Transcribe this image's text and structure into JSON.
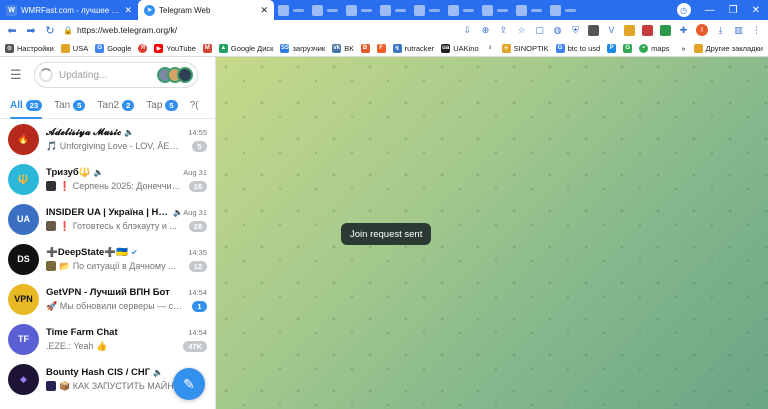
{
  "browser": {
    "tabs": [
      {
        "title": "WMRFast.com - лучшее место дл",
        "favicon": "W",
        "favicon_color": "#4a86e8",
        "active": false
      },
      {
        "title": "Telegram Web",
        "favicon": "➤",
        "favicon_color": "#3390ec",
        "active": true
      }
    ],
    "url": "https://web.telegram.org/k/"
  },
  "bookmarks": [
    {
      "label": "Настройки",
      "icon": "gear-icon",
      "color": "#555555"
    },
    {
      "label": "USA",
      "icon": "folder-icon",
      "color": "#e0a526"
    },
    {
      "label": "Google",
      "icon": "G",
      "color": "#4285f4"
    },
    {
      "label": "",
      "icon": "ya-icon",
      "color": "#e23b2e"
    },
    {
      "label": "YouTube",
      "icon": "▶",
      "color": "#ff0000"
    },
    {
      "label": "",
      "icon": "M",
      "color": "#d44638"
    },
    {
      "label": "Google Диск",
      "icon": "▲",
      "color": "#1fa463"
    },
    {
      "label": "загрузчик",
      "icon": "SS",
      "color": "#2d7be0"
    },
    {
      "label": "ВК",
      "icon": "vk",
      "color": "#4a76a8"
    },
    {
      "label": "",
      "icon": "B",
      "color": "#e05a2a"
    },
    {
      "label": "",
      "icon": "F",
      "color": "#f25c27"
    },
    {
      "label": "rutracker",
      "icon": "↯",
      "color": "#3b78c2"
    },
    {
      "label": "UAKino",
      "icon": "ua",
      "color": "#222222"
    },
    {
      "label": "",
      "icon": "🌡",
      "color": "#333333"
    },
    {
      "label": "SINOPTIK",
      "icon": "☀",
      "color": "#e0a526"
    },
    {
      "label": "btc to usd",
      "icon": "G",
      "color": "#4285f4"
    },
    {
      "label": "",
      "icon": "P",
      "color": "#1e88e5"
    },
    {
      "label": "",
      "icon": "G",
      "color": "#34a853"
    },
    {
      "label": "maps",
      "icon": "📍",
      "color": "#34a853"
    }
  ],
  "bookmarks_other": "Другие закладки",
  "search": {
    "placeholder": "Updating..."
  },
  "folders": [
    {
      "label": "All",
      "count": "23",
      "active": true
    },
    {
      "label": "Tan",
      "count": "5",
      "active": false
    },
    {
      "label": "Tan2",
      "count": "2",
      "active": false
    },
    {
      "label": "Tap",
      "count": "5",
      "active": false
    },
    {
      "label": "?(",
      "count": "",
      "active": false
    }
  ],
  "chats": [
    {
      "name": "𝓐𝓭𝓮𝓵𝓲𝓼𝓲𝔂𝓪 𝓜𝓾𝓼𝓲𝓬",
      "time": "14:55",
      "message": "🎵 Unforgiving Love - LOV, ÂEMY...",
      "unread": "5",
      "unread_color": "grey",
      "avatar_color": "#b52a1c",
      "avatar_text": "🔥"
    },
    {
      "name": "Тризуб🔱",
      "time": "Aug 31",
      "message": "❗ Серпень 2025: Донеччин...",
      "unread": "16",
      "unread_color": "grey",
      "avatar_color": "#2bb7d8",
      "avatar_text": "🔱"
    },
    {
      "name": "INSIDER UA | Україна | Нов...",
      "time": "Aug 31",
      "message": "❗ Готовтесь к блэкауту и ...",
      "unread": "28",
      "unread_color": "grey",
      "avatar_color": "#3a6fc2",
      "avatar_text": "UA"
    },
    {
      "name": "➕DeepState➕🇺🇦",
      "time": "14:35",
      "message": "📂 По ситуації в Дачному ...",
      "unread": "12",
      "unread_color": "grey",
      "avatar_color": "#111111",
      "avatar_text": "DS"
    },
    {
      "name": "GetVPN - Лучший ВПН Бот",
      "time": "14:54",
      "message": "🚀 Мы обновили серверы — ско...",
      "unread": "1",
      "unread_color": "blue",
      "avatar_color": "#e8b825",
      "avatar_text": "VPN"
    },
    {
      "name": "Time Farm Chat",
      "time": "14:54",
      "message": ".EZE.: Yeah 👍",
      "unread": "47K",
      "unread_color": "grey",
      "avatar_color": "#5b5fd6",
      "avatar_text": "TF"
    },
    {
      "name": "Bounty Hash CIS / СНГ",
      "time": "",
      "message": "📦 КАК ЗАПУСТИТЬ МАЙНИН...",
      "unread": "",
      "unread_color": "grey",
      "avatar_color": "#1d1436",
      "avatar_text": "◆"
    }
  ],
  "toast": "Join request sent",
  "colors": {
    "accent": "#3390ec",
    "chrome_blue": "#2a6ef0"
  }
}
